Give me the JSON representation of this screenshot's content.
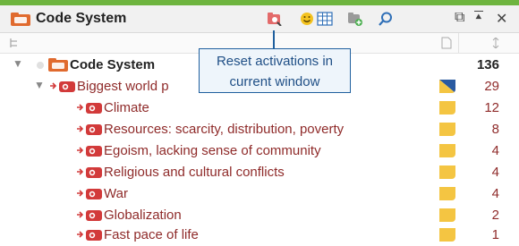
{
  "window": {
    "title": "Code System"
  },
  "toolbar": {
    "icons": [
      "reset-activations-icon",
      "smiley-icon",
      "table-grid-icon",
      "new-code-icon",
      "search-icon",
      "detach-window-icon",
      "collapse-icon",
      "close-icon"
    ],
    "detach_glyph": "⧉",
    "collapse_glyph": "⯅",
    "close_glyph": "✕"
  },
  "tooltip": {
    "line1": "Reset activations in",
    "line2": "current window"
  },
  "tree": {
    "root": {
      "label": "Code System",
      "count": "136"
    },
    "parent": {
      "label": "Biggest world p",
      "count": "29"
    },
    "children": [
      {
        "label": "Climate",
        "count": "12"
      },
      {
        "label": "Resources: scarcity, distribution, poverty",
        "count": "8"
      },
      {
        "label": "Egoism, lacking sense of community",
        "count": "4"
      },
      {
        "label": "Religious and cultural conflicts",
        "count": "4"
      },
      {
        "label": "War",
        "count": "4"
      },
      {
        "label": "Globalization",
        "count": "2"
      },
      {
        "label": "Fast pace of life",
        "count": "1"
      }
    ]
  },
  "colors": {
    "accent_green": "#6eb43f",
    "code_red": "#8f2b2a",
    "flag_yellow": "#f4c542",
    "flag_blue": "#2a5aa0",
    "tooltip_border": "#1f5f9e"
  }
}
